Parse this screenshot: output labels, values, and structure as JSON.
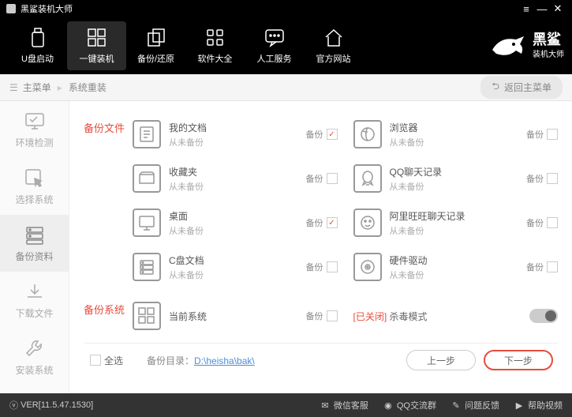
{
  "titlebar": {
    "title": "黑鲨装机大师"
  },
  "topnav": {
    "items": [
      {
        "label": "U盘启动"
      },
      {
        "label": "一键装机"
      },
      {
        "label": "备份/还原"
      },
      {
        "label": "软件大全"
      },
      {
        "label": "人工服务"
      },
      {
        "label": "官方网站"
      }
    ],
    "logo_main": "黑鲨",
    "logo_sub": "装机大师"
  },
  "breadcrumb": {
    "root": "主菜单",
    "current": "系统重装",
    "return_label": "返回主菜单"
  },
  "sidebar": {
    "items": [
      {
        "label": "环境检测"
      },
      {
        "label": "选择系统"
      },
      {
        "label": "备份资料"
      },
      {
        "label": "下载文件"
      },
      {
        "label": "安装系统"
      }
    ]
  },
  "sections": {
    "files_label": "备份文件",
    "system_label": "备份系统",
    "backup_word": "备份",
    "never_backup": "从未备份",
    "items_left": [
      {
        "title": "我的文档",
        "checked": true
      },
      {
        "title": "收藏夹",
        "checked": false
      },
      {
        "title": "桌面",
        "checked": true
      },
      {
        "title": "C盘文档",
        "checked": false
      }
    ],
    "items_right": [
      {
        "title": "浏览器",
        "checked": false
      },
      {
        "title": "QQ聊天记录",
        "checked": false
      },
      {
        "title": "阿里旺旺聊天记录",
        "checked": false
      },
      {
        "title": "硬件驱动",
        "checked": false
      }
    ],
    "system_item": {
      "title": "当前系统",
      "checked": false
    },
    "av_status": "[已关闭]",
    "av_label": "杀毒模式"
  },
  "footer": {
    "select_all": "全选",
    "backup_dir_label": "备份目录：",
    "backup_dir_path": "D:\\heisha\\bak\\",
    "prev": "上一步",
    "next": "下一步"
  },
  "statusbar": {
    "version": "VER[11.5.47.1530]",
    "items": [
      "微信客服",
      "QQ交流群",
      "问题反馈",
      "帮助视频"
    ]
  }
}
